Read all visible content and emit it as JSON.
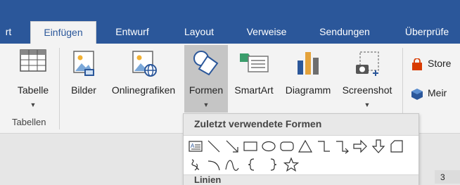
{
  "tabs": [
    {
      "label": "rt",
      "active": false
    },
    {
      "label": "Einfügen",
      "active": true
    },
    {
      "label": "Entwurf",
      "active": false
    },
    {
      "label": "Layout",
      "active": false
    },
    {
      "label": "Verweise",
      "active": false
    },
    {
      "label": "Sendungen",
      "active": false
    },
    {
      "label": "Überprüfe",
      "active": false
    }
  ],
  "ribbon": {
    "tabelle": {
      "label": "Tabelle",
      "icon": "table-icon"
    },
    "bilder": {
      "label": "Bilder",
      "icon": "picture-icon"
    },
    "onlinegrafiken": {
      "label": "Onlinegrafiken",
      "icon": "online-picture-icon"
    },
    "formen": {
      "label": "Formen",
      "icon": "shapes-icon"
    },
    "smartart": {
      "label": "SmartArt",
      "icon": "smartart-icon"
    },
    "diagramm": {
      "label": "Diagramm",
      "icon": "chart-icon"
    },
    "screenshot": {
      "label": "Screenshot",
      "icon": "screenshot-icon"
    },
    "store": {
      "label": "Store",
      "icon": "store-icon"
    },
    "meine": {
      "label": "Meir",
      "icon": "addins-icon"
    },
    "group_tabellen": "Tabellen"
  },
  "dropdown": {
    "header": "Zuletzt verwendete Formen",
    "footer": "Linien",
    "shapes_row1": [
      "text-box-shape",
      "line-shape",
      "arrow-line-shape",
      "rectangle-shape",
      "oval-shape",
      "rounded-rectangle-shape",
      "triangle-shape",
      "elbow-connector-shape",
      "elbow-arrow-connector-shape",
      "right-arrow-shape",
      "down-arrow-shape",
      "snip-rectangle-shape"
    ],
    "shapes_row2": [
      "freeform-scribble-shape",
      "arc-shape",
      "curve-shape",
      "left-brace-shape",
      "right-brace-shape",
      "star-shape"
    ]
  },
  "page_mark": "3",
  "colors": {
    "accent": "#2b579a",
    "ribbon": "#f3f3f3"
  }
}
